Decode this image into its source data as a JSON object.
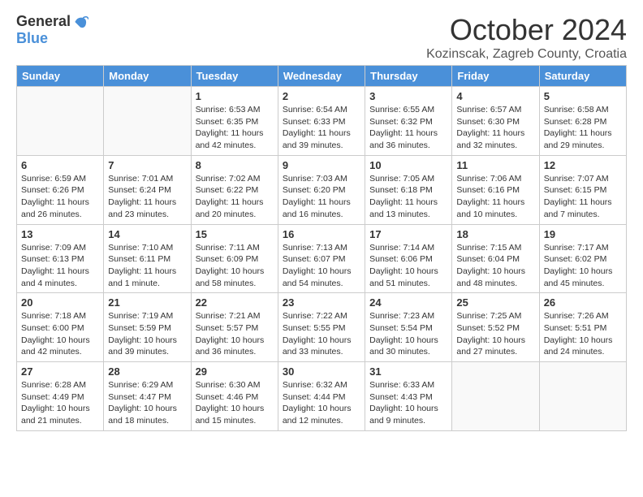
{
  "logo": {
    "general": "General",
    "blue": "Blue"
  },
  "header": {
    "month": "October 2024",
    "location": "Kozinscak, Zagreb County, Croatia"
  },
  "weekdays": [
    "Sunday",
    "Monday",
    "Tuesday",
    "Wednesday",
    "Thursday",
    "Friday",
    "Saturday"
  ],
  "weeks": [
    [
      {
        "day": "",
        "empty": true
      },
      {
        "day": "",
        "empty": true
      },
      {
        "day": "1",
        "sunrise": "6:53 AM",
        "sunset": "6:35 PM",
        "daylight": "11 hours and 42 minutes."
      },
      {
        "day": "2",
        "sunrise": "6:54 AM",
        "sunset": "6:33 PM",
        "daylight": "11 hours and 39 minutes."
      },
      {
        "day": "3",
        "sunrise": "6:55 AM",
        "sunset": "6:32 PM",
        "daylight": "11 hours and 36 minutes."
      },
      {
        "day": "4",
        "sunrise": "6:57 AM",
        "sunset": "6:30 PM",
        "daylight": "11 hours and 32 minutes."
      },
      {
        "day": "5",
        "sunrise": "6:58 AM",
        "sunset": "6:28 PM",
        "daylight": "11 hours and 29 minutes."
      }
    ],
    [
      {
        "day": "6",
        "sunrise": "6:59 AM",
        "sunset": "6:26 PM",
        "daylight": "11 hours and 26 minutes."
      },
      {
        "day": "7",
        "sunrise": "7:01 AM",
        "sunset": "6:24 PM",
        "daylight": "11 hours and 23 minutes."
      },
      {
        "day": "8",
        "sunrise": "7:02 AM",
        "sunset": "6:22 PM",
        "daylight": "11 hours and 20 minutes."
      },
      {
        "day": "9",
        "sunrise": "7:03 AM",
        "sunset": "6:20 PM",
        "daylight": "11 hours and 16 minutes."
      },
      {
        "day": "10",
        "sunrise": "7:05 AM",
        "sunset": "6:18 PM",
        "daylight": "11 hours and 13 minutes."
      },
      {
        "day": "11",
        "sunrise": "7:06 AM",
        "sunset": "6:16 PM",
        "daylight": "11 hours and 10 minutes."
      },
      {
        "day": "12",
        "sunrise": "7:07 AM",
        "sunset": "6:15 PM",
        "daylight": "11 hours and 7 minutes."
      }
    ],
    [
      {
        "day": "13",
        "sunrise": "7:09 AM",
        "sunset": "6:13 PM",
        "daylight": "11 hours and 4 minutes."
      },
      {
        "day": "14",
        "sunrise": "7:10 AM",
        "sunset": "6:11 PM",
        "daylight": "11 hours and 1 minute."
      },
      {
        "day": "15",
        "sunrise": "7:11 AM",
        "sunset": "6:09 PM",
        "daylight": "10 hours and 58 minutes."
      },
      {
        "day": "16",
        "sunrise": "7:13 AM",
        "sunset": "6:07 PM",
        "daylight": "10 hours and 54 minutes."
      },
      {
        "day": "17",
        "sunrise": "7:14 AM",
        "sunset": "6:06 PM",
        "daylight": "10 hours and 51 minutes."
      },
      {
        "day": "18",
        "sunrise": "7:15 AM",
        "sunset": "6:04 PM",
        "daylight": "10 hours and 48 minutes."
      },
      {
        "day": "19",
        "sunrise": "7:17 AM",
        "sunset": "6:02 PM",
        "daylight": "10 hours and 45 minutes."
      }
    ],
    [
      {
        "day": "20",
        "sunrise": "7:18 AM",
        "sunset": "6:00 PM",
        "daylight": "10 hours and 42 minutes."
      },
      {
        "day": "21",
        "sunrise": "7:19 AM",
        "sunset": "5:59 PM",
        "daylight": "10 hours and 39 minutes."
      },
      {
        "day": "22",
        "sunrise": "7:21 AM",
        "sunset": "5:57 PM",
        "daylight": "10 hours and 36 minutes."
      },
      {
        "day": "23",
        "sunrise": "7:22 AM",
        "sunset": "5:55 PM",
        "daylight": "10 hours and 33 minutes."
      },
      {
        "day": "24",
        "sunrise": "7:23 AM",
        "sunset": "5:54 PM",
        "daylight": "10 hours and 30 minutes."
      },
      {
        "day": "25",
        "sunrise": "7:25 AM",
        "sunset": "5:52 PM",
        "daylight": "10 hours and 27 minutes."
      },
      {
        "day": "26",
        "sunrise": "7:26 AM",
        "sunset": "5:51 PM",
        "daylight": "10 hours and 24 minutes."
      }
    ],
    [
      {
        "day": "27",
        "sunrise": "6:28 AM",
        "sunset": "4:49 PM",
        "daylight": "10 hours and 21 minutes."
      },
      {
        "day": "28",
        "sunrise": "6:29 AM",
        "sunset": "4:47 PM",
        "daylight": "10 hours and 18 minutes."
      },
      {
        "day": "29",
        "sunrise": "6:30 AM",
        "sunset": "4:46 PM",
        "daylight": "10 hours and 15 minutes."
      },
      {
        "day": "30",
        "sunrise": "6:32 AM",
        "sunset": "4:44 PM",
        "daylight": "10 hours and 12 minutes."
      },
      {
        "day": "31",
        "sunrise": "6:33 AM",
        "sunset": "4:43 PM",
        "daylight": "10 hours and 9 minutes."
      },
      {
        "day": "",
        "empty": true
      },
      {
        "day": "",
        "empty": true
      }
    ]
  ]
}
